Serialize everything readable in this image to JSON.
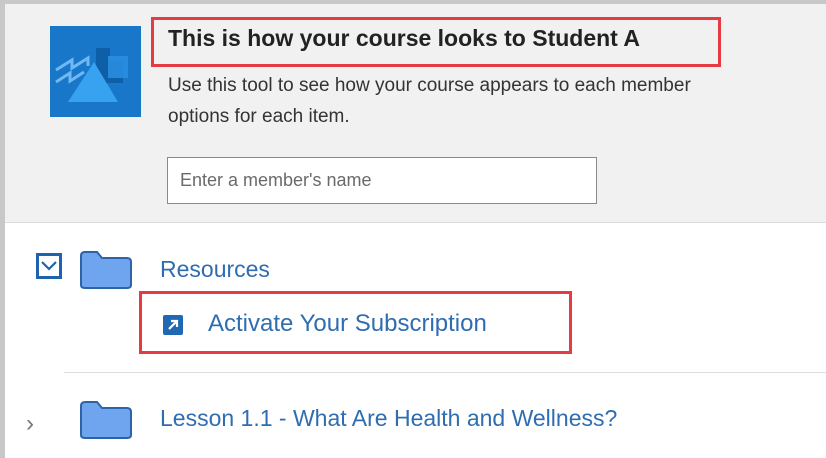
{
  "banner": {
    "title": "This is how your course looks to Student A",
    "description_line1": "Use this tool to see how your course appears to each member",
    "description_line2": "options for each item.",
    "member_input": {
      "placeholder": "Enter a member's name",
      "value": ""
    }
  },
  "content": {
    "folders": [
      {
        "label": "Resources",
        "expanded": true,
        "icon": "folder-icon"
      },
      {
        "label": "Lesson 1.1 - What Are Health and Wellness?",
        "expanded": false,
        "icon": "folder-icon"
      }
    ],
    "items": [
      {
        "label": "Activate Your Subscription",
        "icon": "external-link-icon"
      }
    ]
  },
  "colors": {
    "link": "#2f6db1",
    "highlight": "#e53b42",
    "banner_bg": "#f1f1f1",
    "folder": "#6fa4ef",
    "logo_bg": "#1877c9"
  }
}
